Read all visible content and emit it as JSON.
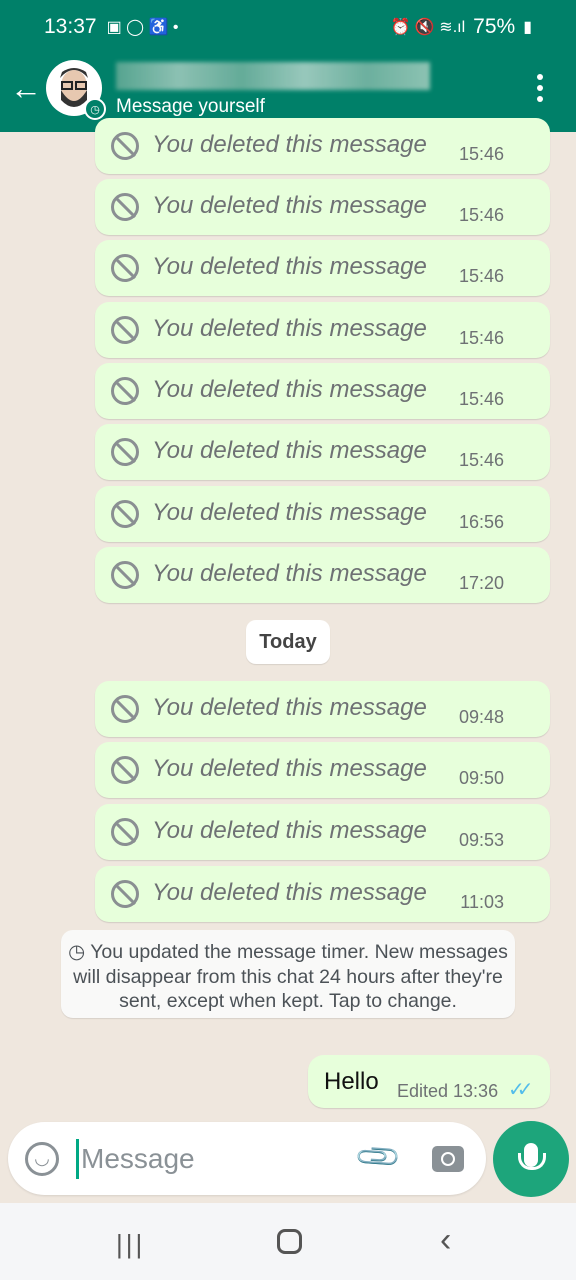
{
  "status_bar": {
    "time": "13:37",
    "battery": "75%",
    "icons": [
      "gallery-icon",
      "whatsapp-icon",
      "accessibility-icon",
      "dot-icon",
      "alarm-icon",
      "mute-icon",
      "wifi-icon",
      "signal-icon",
      "battery-icon"
    ]
  },
  "header": {
    "subtitle": "Message yourself",
    "back_icon": "arrow-left-icon",
    "menu_icon": "more-vert-icon",
    "accent": "#008069"
  },
  "messages_group1": [
    {
      "text": "You deleted this message",
      "time": "15:46"
    },
    {
      "text": "You deleted this message",
      "time": "15:46"
    },
    {
      "text": "You deleted this message",
      "time": "15:46"
    },
    {
      "text": "You deleted this message",
      "time": "15:46"
    },
    {
      "text": "You deleted this message",
      "time": "15:46"
    },
    {
      "text": "You deleted this message",
      "time": "15:46"
    },
    {
      "text": "You deleted this message",
      "time": "16:56"
    },
    {
      "text": "You deleted this message",
      "time": "17:20"
    }
  ],
  "date_chip": "Today",
  "messages_group2": [
    {
      "text": "You deleted this message",
      "time": "09:48"
    },
    {
      "text": "You deleted this message",
      "time": "09:50"
    },
    {
      "text": "You deleted this message",
      "time": "09:53"
    },
    {
      "text": "You deleted this message",
      "time": "11:03"
    }
  ],
  "system_message": "You updated the message timer. New messages will disappear from this chat 24 hours after they're sent, except when kept. Tap to change.",
  "last_message": {
    "text": "Hello",
    "meta": "Edited 13:36",
    "ticks": "✓✓"
  },
  "composer": {
    "placeholder": "Message"
  },
  "colors": {
    "bubble": "#e7ffdb",
    "read_ticks": "#53bdeb",
    "mic": "#1da57b"
  }
}
